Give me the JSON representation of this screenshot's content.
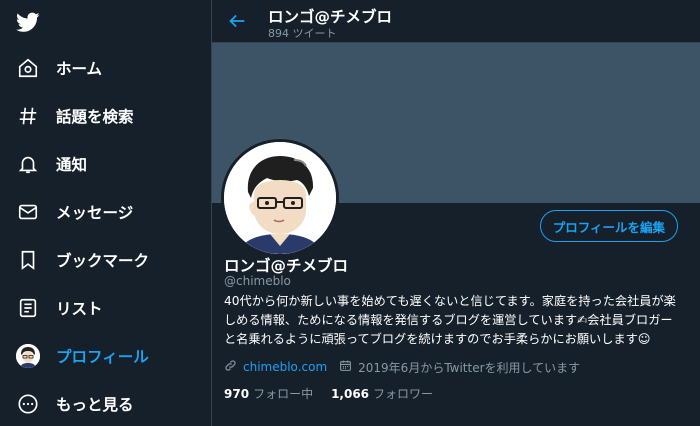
{
  "colors": {
    "background": "#15202b",
    "accent": "#1da1f2",
    "secondary_text": "#8899a6",
    "banner": "#3d5466",
    "border": "#38444d"
  },
  "sidebar": {
    "logo_icon": "twitter-bird-icon",
    "items": [
      {
        "label": "ホーム",
        "icon": "home-icon"
      },
      {
        "label": "話題を検索",
        "icon": "hashtag-icon"
      },
      {
        "label": "通知",
        "icon": "bell-icon"
      },
      {
        "label": "メッセージ",
        "icon": "mail-icon"
      },
      {
        "label": "ブックマーク",
        "icon": "bookmark-icon"
      },
      {
        "label": "リスト",
        "icon": "list-icon"
      },
      {
        "label": "プロフィール",
        "icon": "avatar-icon",
        "active": true
      },
      {
        "label": "もっと見る",
        "icon": "more-icon"
      }
    ]
  },
  "header": {
    "title": "ロンゴ@チメブロ",
    "subtitle": "894 ツイート"
  },
  "profile": {
    "edit_button": "プロフィールを編集",
    "name": "ロンゴ@チメブロ",
    "handle": "@chimeblo",
    "bio_lines": [
      "40代から何か新しい事を始めても遅くないと信じてます。家庭を持った会社員が楽",
      "しめる情報、ためになる情報を発信するブログを運営しています✍会社員ブロガー",
      "と名乗れるように頑張ってブログを続けますのでお手柔らかにお願いします☺"
    ],
    "website": "chimeblo.com",
    "joined": "2019年6月からTwitterを利用しています",
    "following_count": "970",
    "following_label": "フォロー中",
    "followers_count": "1,066",
    "followers_label": "フォロワー"
  }
}
